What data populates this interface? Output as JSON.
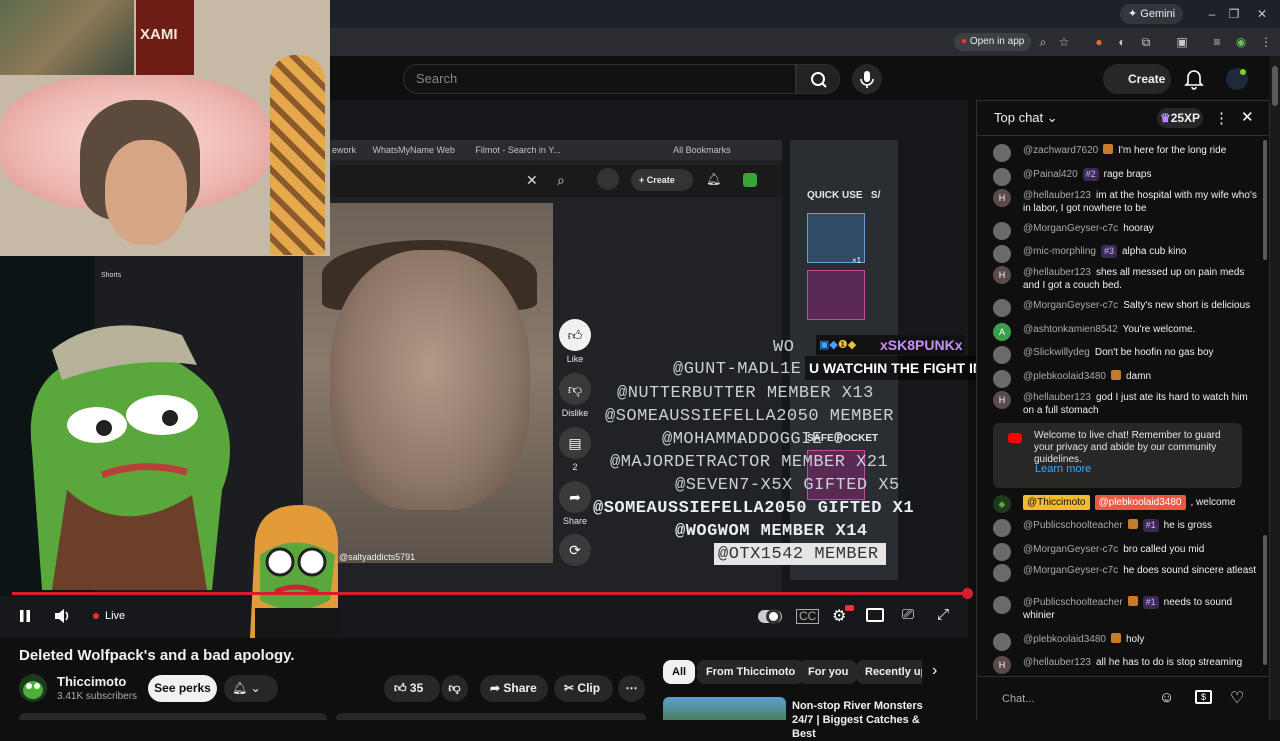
{
  "browser": {
    "gemini_label": "Gemini",
    "open_in_app_label": "Open in app"
  },
  "header": {
    "search_placeholder": "Search",
    "create_label": "Create"
  },
  "webcam": {
    "poster_text": "XAMI"
  },
  "stream_screen": {
    "bookmarks": [
      "ework",
      "WhatsMyName Web",
      "Filmot - Search in Y...",
      "All Bookmarks"
    ],
    "inner_create_label": "Create",
    "quick_use_label": "QUICK USE",
    "quick_use_label_2": "S/",
    "slot_count": "×1",
    "safe_pocket_label": "SAFE POCKET",
    "shorts_label": "Shorts",
    "side_actions": [
      {
        "icon": "like-icon",
        "label": "Like"
      },
      {
        "icon": "dislike-icon",
        "label": "Dislike"
      },
      {
        "icon": "comment-icon",
        "label": "2"
      },
      {
        "icon": "share-icon",
        "label": "Share"
      },
      {
        "icon": "remix-icon",
        "label": ""
      }
    ],
    "overlay_lines": [
      "WO",
      "@GUNT-MADL1E",
      "@NUTTERBUTTER MEMBER X13",
      "@SOMEAUSSIEFELLA2050 MEMBER",
      "@MOHAMMADDOGGIE 0",
      "@MAJORDETRACTOR MEMBER X21",
      "@SEVEN7-X5X GIFTED X5",
      "@SOMEAUSSIEFELLA2050 GIFTED X1",
      "@WOGWOM MEMBER X14",
      "@OTX1542 MEMBER"
    ],
    "pepe_username": "@saltyaddicts5791"
  },
  "video_overlay_chat": {
    "author": "xSK8PUNKx",
    "message": "U WATCHIN THE FIGHT IN PERSON"
  },
  "player": {
    "live_label": "Live",
    "progress": 1.0
  },
  "video": {
    "title": "Deleted Wolfpack's and a bad apology.",
    "channel_name": "Thiccimoto",
    "subscribers": "3.41K subscribers",
    "perks_label": "See perks",
    "like_count": "35",
    "share_label": "Share",
    "clip_label": "Clip"
  },
  "recommendations": {
    "filters": [
      "All",
      "From Thiccimoto",
      "For you",
      "Recently up"
    ],
    "first_title": "Non-stop River Monsters 24/7 | Biggest Catches & Best"
  },
  "chat": {
    "mode_label": "Top chat",
    "xp_label": "25XP",
    "messages": [
      {
        "avatar": "",
        "author": "@zachward7620",
        "badge": "",
        "emoji": true,
        "text": "I'm here for the long ride"
      },
      {
        "avatar": "",
        "author": "@Painal420",
        "badge": "#2",
        "emoji": false,
        "text": "rage braps"
      },
      {
        "avatar": "H",
        "author": "@hellauber123",
        "badge": "",
        "emoji": false,
        "text": "im at the hospital with my wife who's in labor, I got nowhere to be"
      },
      {
        "avatar": "",
        "author": "@MorganGeyser-c7c",
        "badge": "",
        "emoji": false,
        "text": "hooray"
      },
      {
        "avatar": "",
        "author": "@mic-morphling",
        "badge": "#3",
        "emoji": false,
        "text": "alpha cub kino"
      },
      {
        "avatar": "H",
        "author": "@hellauber123",
        "badge": "",
        "emoji": false,
        "text": "shes all messed up on pain meds and I got a couch bed."
      },
      {
        "avatar": "",
        "author": "@MorganGeyser-c7c",
        "badge": "",
        "emoji": false,
        "text": "Salty's new short is delicious"
      },
      {
        "avatar": "A",
        "author": "@ashtonkamien8542",
        "badge": "",
        "emoji": false,
        "text": "You're welcome."
      },
      {
        "avatar": "",
        "author": "@Slickwillydeg",
        "badge": "",
        "emoji": false,
        "text": "Don't be hoofin no gas boy"
      },
      {
        "avatar": "",
        "author": "@plebkoolaid3480",
        "badge": "",
        "emoji": true,
        "text": "damn"
      },
      {
        "avatar": "H",
        "author": "@hellauber123",
        "badge": "",
        "emoji": false,
        "text": "god I just ate its hard to watch him on a full stomach"
      }
    ],
    "welcome_text": "Welcome to live chat! Remember to guard your privacy and abide by our community guidelines.",
    "learn_more": "Learn more",
    "owner_message": {
      "author": "@Thiccimoto",
      "mention": "@plebkoolaid3480",
      "text": ", welcome"
    },
    "messages2": [
      {
        "avatar": "",
        "author": "@Publicschoolteacher",
        "badge": "#1",
        "emoji": true,
        "text": "he is gross"
      },
      {
        "avatar": "",
        "author": "@MorganGeyser-c7c",
        "badge": "",
        "emoji": false,
        "text": "bro called you mid"
      },
      {
        "avatar": "",
        "author": "@MorganGeyser-c7c",
        "badge": "",
        "emoji": false,
        "text": "he does sound sincere atleast"
      },
      {
        "avatar": "",
        "author": "@Publicschoolteacher",
        "badge": "#1",
        "emoji": true,
        "text": "needs to sound whinier"
      },
      {
        "avatar": "",
        "author": "@plebkoolaid3480",
        "badge": "",
        "emoji": true,
        "text": "holy"
      },
      {
        "avatar": "H",
        "author": "@hellauber123",
        "badge": "",
        "emoji": false,
        "text": "all he has to do is stop streaming"
      }
    ],
    "input_placeholder": "Chat..."
  },
  "colors": {
    "accent_red": "#d61f2c",
    "link_blue": "#3ea6ff",
    "owner_yellow": "#f2bb2e"
  }
}
